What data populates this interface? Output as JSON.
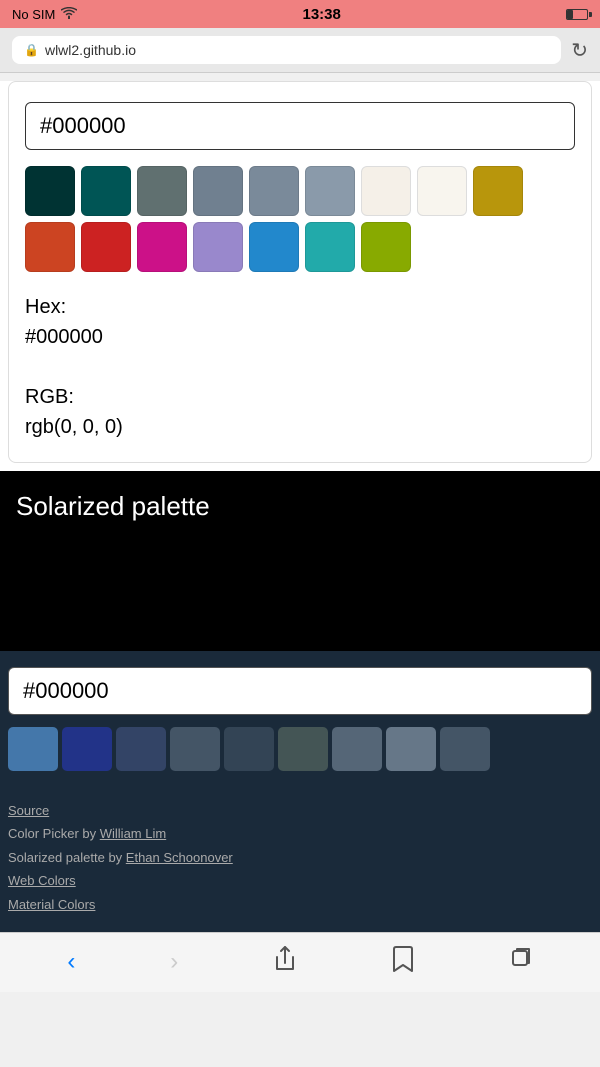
{
  "statusBar": {
    "carrier": "No SIM",
    "time": "13:38",
    "batteryLevel": 30
  },
  "addressBar": {
    "url": "wlwl2.github.io",
    "reloadLabel": "↻"
  },
  "colorPicker": {
    "hexInputValue": "#000000",
    "hexInputValueDark": "#000000",
    "hexLabel": "Hex:",
    "hexValue": "#000000",
    "rgbLabel": "RGB:",
    "rgbValue": "rgb(0, 0, 0)",
    "swatches": [
      "#003333",
      "#005555",
      "#607070",
      "#708090",
      "#7a8a9a",
      "#8a9aaa",
      "#f5f0e8",
      "#f8f5ee",
      "#b8960c",
      "#cc4422",
      "#cc2222",
      "#cc1188",
      "#9988cc",
      "#2288cc",
      "#22aaaa",
      "#88aa00"
    ]
  },
  "solarizedSection": {
    "title": "Solarized palette"
  },
  "darkColorPicker": {
    "swatches": [
      "#336699",
      "#223388",
      "#334466",
      "#445566",
      "#334455",
      "#445555",
      "#556677",
      "#667788",
      "#445566"
    ]
  },
  "footer": {
    "sourceLabel": "Source",
    "creditLine1": "Color Picker by ",
    "authorName": "William Lim",
    "creditLine2": "Solarized palette by ",
    "solarizedAuthor": "Ethan Schoonover",
    "webColorsLabel": "Web Colors",
    "materialColorsLabel": "Material Colors"
  },
  "browserNav": {
    "backLabel": "‹",
    "forwardLabel": "›",
    "shareLabel": "↑",
    "bookmarkLabel": "□",
    "tabsLabel": "⧉"
  }
}
